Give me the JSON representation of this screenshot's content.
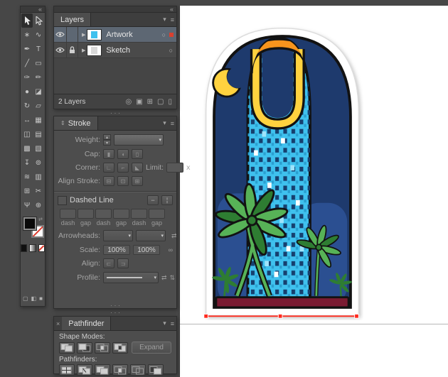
{
  "app": {
    "background": "#474747"
  },
  "icons": {
    "collapse": "«",
    "panel_menu": "≡",
    "menu_arrow": "▾",
    "disclosure": "▶",
    "target": "○",
    "swap": "⇄",
    "link": "∞",
    "flip_h": "⇄",
    "flip_v": "⇅",
    "spin_up": "▴",
    "spin_down": "▾",
    "combo_arrow": "▾",
    "close": "×",
    "accordion": "⇕",
    "cap": [
      "▮",
      "◖",
      "▯"
    ],
    "corner": [
      "∟",
      "⌐",
      "◣"
    ],
    "align_stroke": [
      "⊟",
      "⊡",
      "⊞"
    ],
    "dash_align": [
      "╍",
      "╏"
    ],
    "dash_align2": [
      "⊏",
      "⊐"
    ]
  },
  "toolbar": {
    "tools": [
      {
        "name": "selection",
        "icon": "cursor-black",
        "selected": true
      },
      {
        "name": "direct-selection",
        "icon": "cursor-white"
      },
      {
        "name": "magic-wand",
        "glyph": "∗"
      },
      {
        "name": "lasso",
        "glyph": "∿"
      },
      {
        "name": "pen",
        "glyph": "✒"
      },
      {
        "name": "type",
        "glyph": "T"
      },
      {
        "name": "line-segment",
        "glyph": "╱"
      },
      {
        "name": "rectangle",
        "glyph": "▭"
      },
      {
        "name": "paintbrush",
        "glyph": "✑"
      },
      {
        "name": "pencil",
        "glyph": "✏"
      },
      {
        "name": "blob-brush",
        "glyph": "●"
      },
      {
        "name": "eraser",
        "glyph": "◪"
      },
      {
        "name": "rotate",
        "glyph": "↻"
      },
      {
        "name": "scale",
        "glyph": "▱"
      },
      {
        "name": "width",
        "glyph": "↔"
      },
      {
        "name": "free-transform",
        "glyph": "▦"
      },
      {
        "name": "shape-builder",
        "glyph": "◫"
      },
      {
        "name": "perspective-grid",
        "glyph": "▤"
      },
      {
        "name": "mesh",
        "glyph": "▩"
      },
      {
        "name": "gradient",
        "glyph": "▧"
      },
      {
        "name": "eyedropper",
        "glyph": "↧"
      },
      {
        "name": "blend",
        "glyph": "⊚"
      },
      {
        "name": "symbol-sprayer",
        "glyph": "≋"
      },
      {
        "name": "column-graph",
        "glyph": "▥"
      },
      {
        "name": "artboard",
        "glyph": "⊞"
      },
      {
        "name": "slice",
        "glyph": "✂"
      },
      {
        "name": "hand",
        "glyph": "Ψ"
      },
      {
        "name": "zoom",
        "glyph": "⊕"
      }
    ],
    "screen_modes": [
      {
        "name": "screen-mode-normal",
        "glyph": "▢"
      },
      {
        "name": "screen-mode-menu",
        "glyph": "◧"
      },
      {
        "name": "screen-mode-full",
        "glyph": "■"
      }
    ]
  },
  "layers_panel": {
    "title": "Layers",
    "rows": [
      {
        "name": "Artwork",
        "visible": true,
        "locked": false,
        "selected": true,
        "selection_color": "#d8402f"
      },
      {
        "name": "Sketch",
        "visible": true,
        "locked": true,
        "selected": false
      }
    ],
    "status": "2 Layers",
    "footer_buttons": [
      {
        "name": "locate-object",
        "glyph": "◎"
      },
      {
        "name": "make-clipping-mask",
        "glyph": "▣"
      },
      {
        "name": "new-sublayer",
        "glyph": "⊞"
      },
      {
        "name": "new-layer",
        "glyph": "▢"
      },
      {
        "name": "delete-layer",
        "glyph": "▯"
      }
    ]
  },
  "stroke_panel": {
    "title": "Stroke",
    "weight_label": "Weight:",
    "cap_label": "Cap:",
    "corner_label": "Corner:",
    "limit_label": "Limit:",
    "limit_suffix": "x",
    "align_stroke_label": "Align Stroke:",
    "dashed_line_label": "Dashed Line",
    "dash_gap_labels": [
      "dash",
      "gap",
      "dash",
      "gap",
      "dash",
      "gap"
    ],
    "arrowheads_label": "Arrowheads:",
    "scale_label": "Scale:",
    "scale_values": [
      "100%",
      "100%"
    ],
    "align_label": "Align:",
    "profile_label": "Profile:"
  },
  "pathfinder_panel": {
    "title": "Pathfinder",
    "shape_modes_label": "Shape Modes:",
    "shape_modes": [
      "unite",
      "minus-front",
      "intersect",
      "exclude"
    ],
    "expand_label": "Expand",
    "pathfinders_label": "Pathfinders:",
    "pathfinders": [
      "divide",
      "trim",
      "merge",
      "crop",
      "outline",
      "minus-back"
    ]
  },
  "artwork": {
    "description": "Kingdom Centre tower night-scene sticker with crescent moon, palm trees and red selected base path",
    "colors": {
      "sticker": "#ffffff",
      "sky": "#1e3a6d",
      "hills": "#2b4f91",
      "tower": "#3fc1ee",
      "windows": "#16406f",
      "windowsAlt": "#2a9fd0",
      "sparkle": "#ffffff",
      "sparkleBlue": "#9fe3fb",
      "moon": "#ffd23f",
      "archYellow": "#ffd23f",
      "archOrange": "#f7941d",
      "palm": "#57b257",
      "palmDark": "#2e7d32",
      "base": "#7a1b32",
      "outline": "#121212",
      "selection": "#ff2a1e"
    }
  }
}
